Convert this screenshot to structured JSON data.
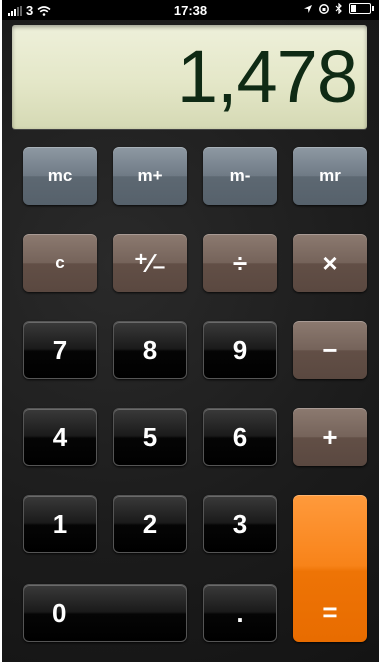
{
  "status_bar": {
    "carrier": "3",
    "time": "17:38",
    "battery_level": 0.3
  },
  "display": {
    "value": "1,478"
  },
  "keys": {
    "mc": "mc",
    "m_plus": "m+",
    "m_minus": "m-",
    "mr": "mr",
    "clear": "c",
    "plus_minus": "⁺∕₋",
    "divide": "÷",
    "multiply": "×",
    "seven": "7",
    "eight": "8",
    "nine": "9",
    "minus": "−",
    "four": "4",
    "five": "5",
    "six": "6",
    "plus": "+",
    "one": "1",
    "two": "2",
    "three": "3",
    "equals": "=",
    "zero": "0",
    "decimal": "."
  },
  "colors": {
    "memory_key": "#6f7a85",
    "operator_key": "#75635a",
    "number_key": "#111111",
    "equals_key": "#f88319",
    "display_bg": "#e4e7c8",
    "display_text": "#0f2a14"
  }
}
